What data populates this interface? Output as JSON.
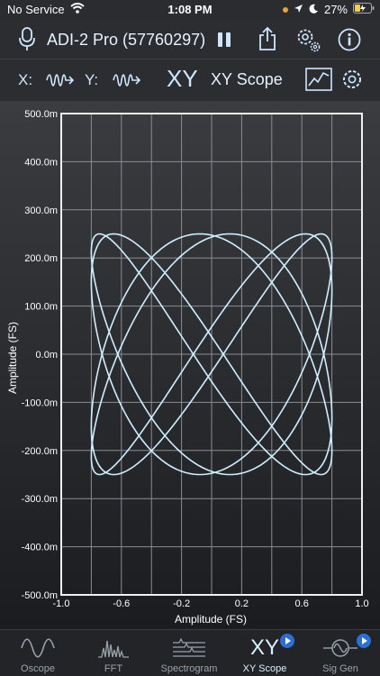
{
  "status": {
    "carrier": "No Service",
    "time": "1:08 PM",
    "battery": "27%"
  },
  "header": {
    "device_title": "ADI-2 Pro (57760297)"
  },
  "controls": {
    "x_label": "X:",
    "y_label": "Y:",
    "xy_big": "XY",
    "mode_title": "XY Scope"
  },
  "colors": {
    "accent": "#cfe6ff",
    "trace": "#cfefff",
    "grid": "#8a8d92"
  },
  "chart_data": {
    "type": "scatter",
    "xlabel": "Amplitude (FS)",
    "ylabel": "Amplitude (FS)",
    "xlim": [
      -1.0,
      1.0
    ],
    "ylim": [
      -500,
      500
    ],
    "x_ticks": [
      "-1.0",
      "-0.6",
      "-0.2",
      "0.2",
      "0.6",
      "1.0"
    ],
    "x_tick_values": [
      -1.0,
      -0.6,
      -0.2,
      0.2,
      0.6,
      1.0
    ],
    "y_ticks": [
      "500.0m",
      "400.0m",
      "300.0m",
      "200.0m",
      "100.0m",
      "0.0m",
      "-100.0m",
      "-200.0m",
      "-300.0m",
      "-400.0m",
      "-500.0m"
    ],
    "y_tick_values": [
      500,
      400,
      300,
      200,
      100,
      0,
      -100,
      -200,
      -300,
      -400,
      -500
    ],
    "grid": true,
    "lissajous": {
      "x_amplitude": 0.8,
      "y_amplitude": 250,
      "x_freq": 2,
      "y_freq": 3,
      "phases": [
        0.95,
        1.2
      ]
    }
  },
  "tabs": [
    {
      "label": "Oscope",
      "icon": "sine-wave-icon",
      "active": false
    },
    {
      "label": "FFT",
      "icon": "fft-icon",
      "active": false
    },
    {
      "label": "Spectrogram",
      "icon": "spectrogram-icon",
      "active": false
    },
    {
      "label": "XY Scope",
      "icon": "xy-icon",
      "active": true
    },
    {
      "label": "Sig Gen",
      "icon": "signal-generator-icon",
      "active": false
    }
  ]
}
